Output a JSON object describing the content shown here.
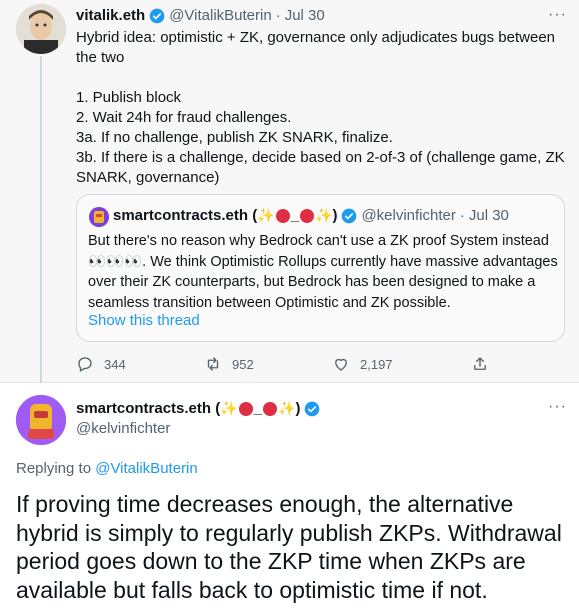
{
  "tweet1": {
    "author_name": "vitalik.eth",
    "author_handle": "@VitalikButerin",
    "separator": "·",
    "date": "Jul 30",
    "more": "···",
    "lines": [
      "Hybrid idea: optimistic + ZK, governance only adjudicates bugs between the two",
      "1. Publish block",
      "2. Wait 24h for fraud challenges.",
      "3a. If no challenge, publish ZK SNARK, finalize.",
      "3b. If there is a challenge, decide based on 2-of-3 of (challenge game, ZK SNARK, governance)"
    ],
    "quote": {
      "author_name": "smartcontracts.eth (",
      "author_name_close": ")",
      "author_handle": "@kelvinfichter",
      "separator": "·",
      "date": "Jul 30",
      "body": "But there's no reason why Bedrock can't use a ZK proof System instead 👀👀👀. We think Optimistic Rollups currently have massive advantages over their ZK counterparts, but Bedrock has been designed to make a seamless transition between Optimistic and ZK possible.",
      "show_thread": "Show this thread"
    },
    "stats": {
      "replies": "344",
      "retweets": "952",
      "likes": "2,197"
    }
  },
  "tweet2": {
    "author_name": "smartcontracts.eth (",
    "author_name_close": ")",
    "author_handle": "@kelvinfichter",
    "more": "···",
    "replying_prefix": "Replying to",
    "replying_to": "@VitalikButerin",
    "body": "If proving time decreases enough, the alternative hybrid is simply to regularly publish ZKPs. Withdrawal period goes down to the ZKP time when ZKPs are available but falls back to optimistic time if not."
  },
  "colors": {
    "accent": "#1d9bf0",
    "muted": "#536471",
    "text": "#0f1419",
    "emoji_red": "#dd2e44",
    "emoji_spark": "#f5b400"
  }
}
